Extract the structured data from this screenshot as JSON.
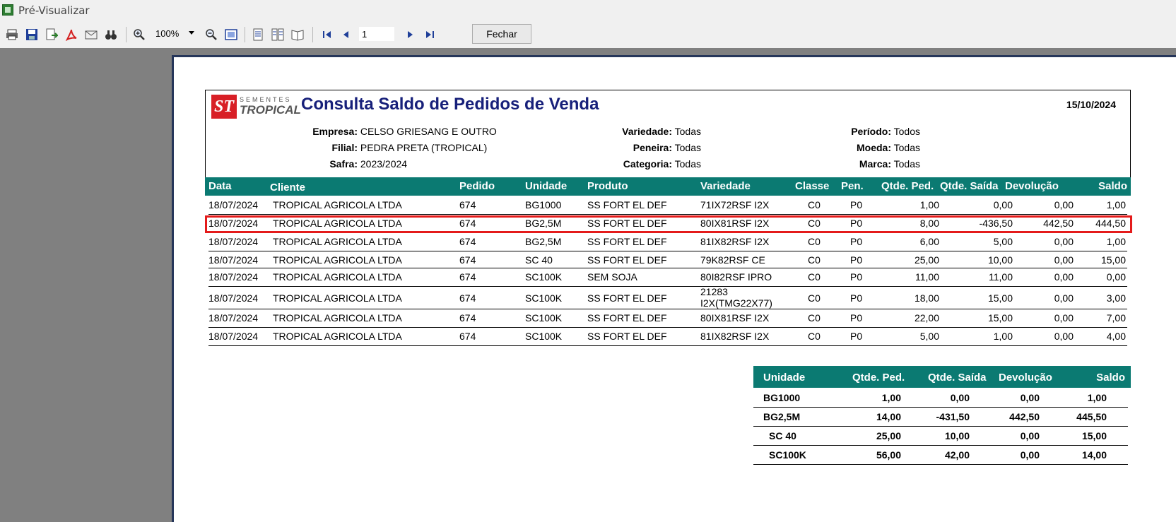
{
  "window": {
    "title": "Pré-Visualizar"
  },
  "toolbar": {
    "zoom": "100%",
    "page": "1",
    "close_label": "Fechar"
  },
  "report": {
    "title": "Consulta Saldo de Pedidos de Venda",
    "date": "15/10/2024",
    "logo": {
      "mark": "ST",
      "top": "SEMENTES",
      "bottom": "TROPICAL"
    },
    "filters": [
      {
        "key": "Empresa:",
        "value": "CELSO GRIESANG E OUTRO"
      },
      {
        "key": "Filial:",
        "value": "PEDRA PRETA (TROPICAL)"
      },
      {
        "key": "Safra:",
        "value": "2023/2024"
      },
      {
        "key": "Variedade:",
        "value": "Todas"
      },
      {
        "key": "Peneira:",
        "value": "Todas"
      },
      {
        "key": "Categoria:",
        "value": "Todas"
      },
      {
        "key": "Período:",
        "value": "Todos"
      },
      {
        "key": "Moeda:",
        "value": "Todas"
      },
      {
        "key": "Marca:",
        "value": "Todas"
      }
    ],
    "columns": [
      "Data",
      "Cliente",
      "Pedido",
      "Unidade",
      "Produto",
      "Variedade",
      "Classe",
      "Pen.",
      "Qtde. Ped.",
      "Qtde. Saída",
      "Devolução",
      "Saldo"
    ],
    "rows": [
      [
        "18/07/2024",
        "TROPICAL AGRICOLA LTDA",
        "674",
        "BG1000",
        "SS FORT EL DEF",
        "71IX72RSF I2X",
        "C0",
        "P0",
        "1,00",
        "0,00",
        "0,00",
        "1,00"
      ],
      [
        "18/07/2024",
        "TROPICAL AGRICOLA LTDA",
        "674",
        "BG2,5M",
        "SS FORT EL DEF",
        "80IX81RSF I2X",
        "C0",
        "P0",
        "8,00",
        "-436,50",
        "442,50",
        "444,50"
      ],
      [
        "18/07/2024",
        "TROPICAL AGRICOLA LTDA",
        "674",
        "BG2,5M",
        "SS FORT EL DEF",
        "81IX82RSF I2X",
        "C0",
        "P0",
        "6,00",
        "5,00",
        "0,00",
        "1,00"
      ],
      [
        "18/07/2024",
        "TROPICAL AGRICOLA LTDA",
        "674",
        "SC 40",
        "SS FORT EL DEF",
        "79K82RSF CE",
        "C0",
        "P0",
        "25,00",
        "10,00",
        "0,00",
        "15,00"
      ],
      [
        "18/07/2024",
        "TROPICAL AGRICOLA LTDA",
        "674",
        "SC100K",
        "SEM SOJA",
        "80I82RSF IPRO",
        "C0",
        "P0",
        "11,00",
        "11,00",
        "0,00",
        "0,00"
      ],
      [
        "18/07/2024",
        "TROPICAL AGRICOLA LTDA",
        "674",
        "SC100K",
        "SS FORT EL DEF",
        "21283",
        "C0",
        "P0",
        "18,00",
        "15,00",
        "0,00",
        "3,00"
      ],
      [
        "18/07/2024",
        "TROPICAL AGRICOLA LTDA",
        "674",
        "SC100K",
        "SS FORT EL DEF",
        "80IX81RSF I2X",
        "C0",
        "P0",
        "22,00",
        "15,00",
        "0,00",
        "7,00"
      ],
      [
        "18/07/2024",
        "TROPICAL AGRICOLA LTDA",
        "674",
        "SC100K",
        "SS FORT EL DEF",
        "81IX82RSF I2X",
        "C0",
        "P0",
        "5,00",
        "1,00",
        "0,00",
        "4,00"
      ]
    ],
    "row6_variety_line2": "I2X(TMG22X77)",
    "summary": {
      "columns": [
        "Unidade",
        "Qtde. Ped.",
        "Qtde. Saída",
        "Devolução",
        "Saldo"
      ],
      "rows": [
        [
          "BG1000",
          "1,00",
          "0,00",
          "0,00",
          "1,00"
        ],
        [
          "BG2,5M",
          "14,00",
          "-431,50",
          "442,50",
          "445,50"
        ],
        [
          "SC 40",
          "25,00",
          "10,00",
          "0,00",
          "15,00"
        ],
        [
          "SC100K",
          "56,00",
          "42,00",
          "0,00",
          "14,00"
        ]
      ]
    }
  },
  "colors": {
    "header_teal": "#0b7a72",
    "title_blue": "#17207a",
    "highlight_red": "#e41b1b"
  }
}
